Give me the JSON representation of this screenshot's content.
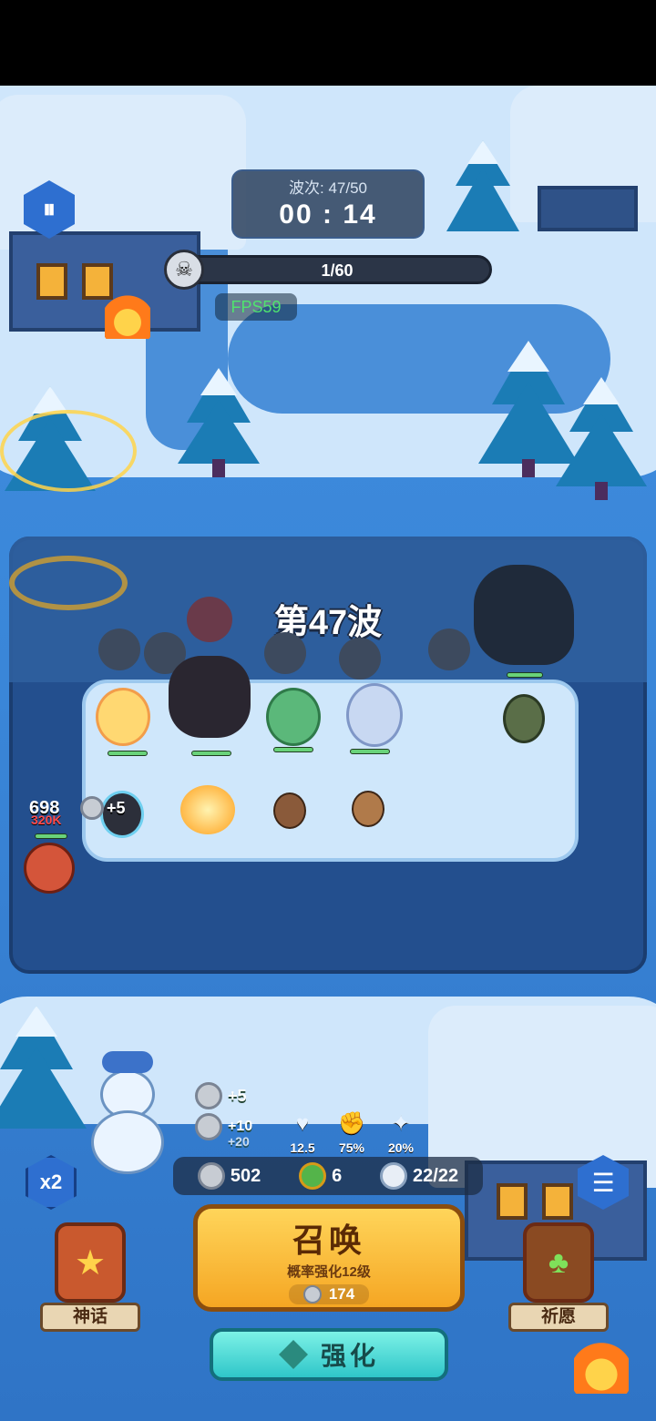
{
  "hud": {
    "wave_label": "波次: 47/50",
    "timer": "00 : 14",
    "kill_progress": "1/60",
    "fps": "FPS59",
    "wave_banner": "第47波"
  },
  "battle": {
    "damage_text": "698",
    "damage_sub": "320K",
    "coin_gain": "+5"
  },
  "economy": {
    "gains": [
      "+5",
      "+10",
      "+20"
    ],
    "silver": "502",
    "clover": "6",
    "population": "22/22"
  },
  "buffs": [
    {
      "icon": "heart-icon",
      "value": "12.5"
    },
    {
      "icon": "fist-icon",
      "value": "75%"
    },
    {
      "icon": "star-up-icon",
      "value": "20%"
    }
  ],
  "controls": {
    "speed_label": "x2",
    "myth_label": "神话",
    "wish_label": "祈愿",
    "summon_title": "召唤",
    "summon_sub": "概率强化12级",
    "summon_cost": "174",
    "upgrade_label": "强化"
  },
  "colors": {
    "accent_gold": "#f5a623",
    "accent_teal": "#2fc6c9",
    "hp_green": "#69d37a",
    "fps_green": "#4fe36f"
  }
}
